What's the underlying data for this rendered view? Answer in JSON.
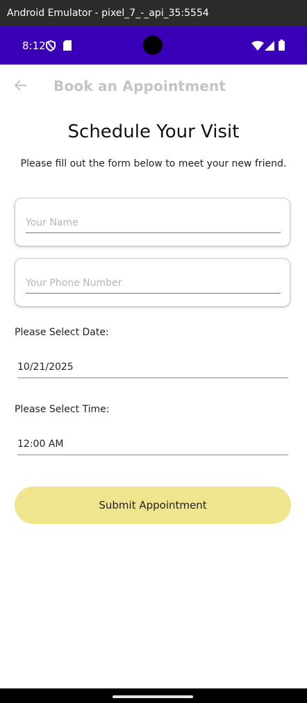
{
  "window": {
    "title": "Android Emulator - pixel_7_-_api_35:5554"
  },
  "status_bar": {
    "time": "8:12",
    "color": "#3a00b8"
  },
  "app_bar": {
    "title": "Book an Appointment"
  },
  "form": {
    "heading": "Schedule Your Visit",
    "subheading": "Please fill out the form below to meet your new friend.",
    "name_placeholder": "Your Name",
    "phone_placeholder": "Your Phone Number",
    "date_label": "Please Select Date:",
    "date_value": "10/21/2025",
    "time_label": "Please Select Time:",
    "time_value": "12:00 AM",
    "submit_label": "Submit Appointment",
    "submit_color": "#efe58e"
  }
}
